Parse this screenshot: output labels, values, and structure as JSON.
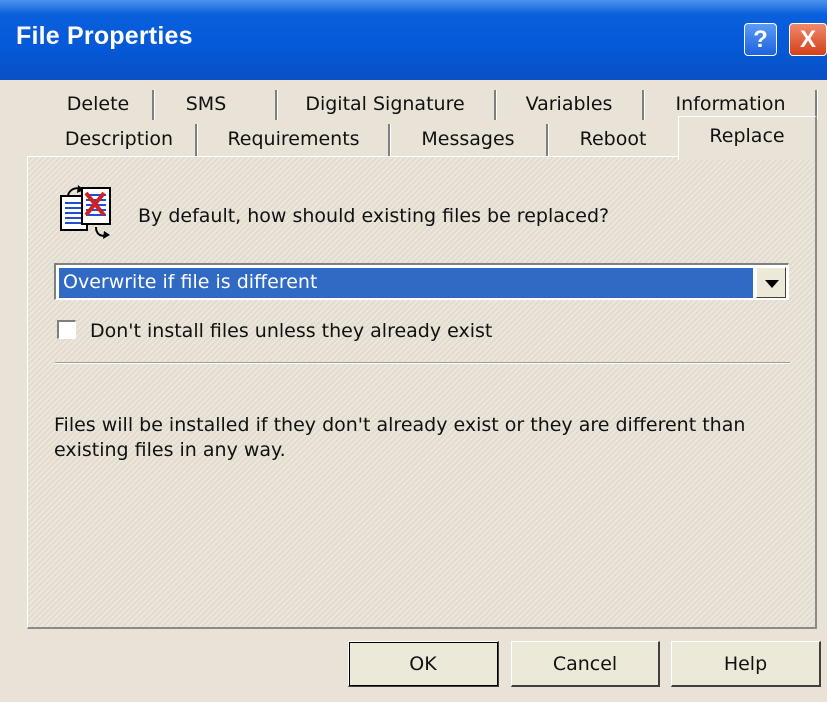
{
  "window": {
    "title": "File Properties",
    "help_button": "?",
    "close_button": "X"
  },
  "tabs": {
    "row1": [
      "Delete",
      "SMS",
      "Digital Signature",
      "Variables",
      "Information"
    ],
    "row2": [
      "Description",
      "Requirements",
      "Messages",
      "Reboot",
      "Replace"
    ],
    "active": "Replace"
  },
  "content": {
    "question": "By default, how should existing files be replaced?",
    "dropdown_value": "Overwrite if file is different",
    "checkbox_label": "Don't install files unless they already exist",
    "checkbox_checked": false,
    "description": "Files will be installed if they don't already exist or they are different than existing files in any way."
  },
  "buttons": {
    "ok": "OK",
    "cancel": "Cancel",
    "help": "Help"
  },
  "colors": {
    "title_bar": "#0a5fdc",
    "selection": "#316ac5",
    "dialog_bg": "#e9e2d6"
  }
}
